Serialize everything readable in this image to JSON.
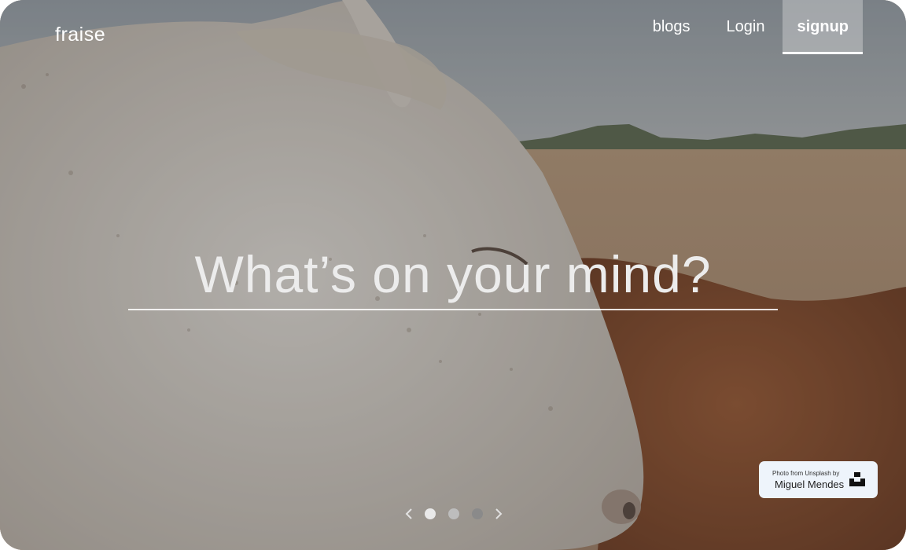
{
  "brand": {
    "logo_text": "fraise"
  },
  "nav": {
    "items": [
      {
        "label": "blogs",
        "active": false
      },
      {
        "label": "Login",
        "active": false
      },
      {
        "label": "signup",
        "active": true
      }
    ]
  },
  "hero": {
    "placeholder": "What’s on your mind?",
    "value": ""
  },
  "carousel": {
    "prev_icon": "chevron-left-icon",
    "next_icon": "chevron-right-icon",
    "slide_count": 3,
    "active_slide": 1
  },
  "credit": {
    "prefix": "Photo from Unsplash by",
    "author": "Miguel Mendes",
    "icon": "unsplash-logo-icon"
  },
  "colors": {
    "overlay_text": "#ffffff",
    "credit_bg": "#eef4fb"
  }
}
